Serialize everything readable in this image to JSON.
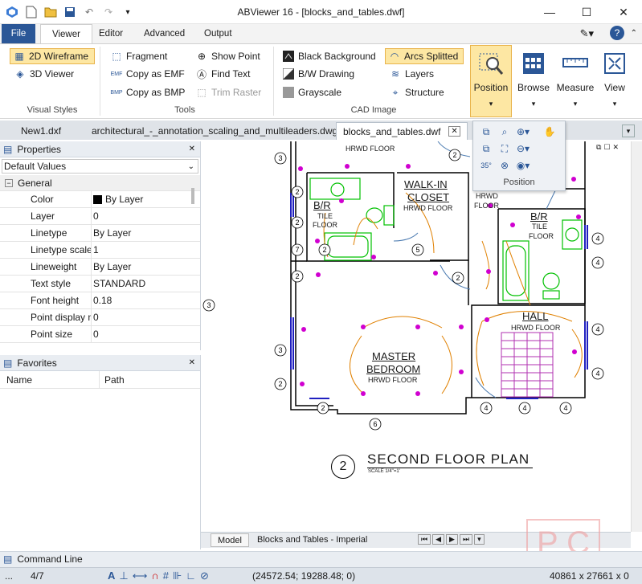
{
  "app": {
    "title": "ABViewer 16 - [blocks_and_tables.dwf]"
  },
  "ribbon_tabs": [
    "File",
    "Viewer",
    "Editor",
    "Advanced",
    "Output"
  ],
  "ribbon": {
    "visual_styles": {
      "label": "Visual Styles",
      "items": [
        "2D Wireframe",
        "3D Viewer"
      ]
    },
    "tools": {
      "label": "Tools",
      "items": [
        "Fragment",
        "Copy as EMF",
        "Copy as BMP",
        "Show Point",
        "Find Text",
        "Trim Raster"
      ]
    },
    "cad_image": {
      "label": "CAD Image",
      "items": [
        "Black Background",
        "B/W Drawing",
        "Grayscale",
        "Arcs Splitted",
        "Layers",
        "Structure"
      ]
    },
    "big_buttons": [
      "Position",
      "Browse",
      "Measure",
      "View"
    ]
  },
  "position_popup": {
    "label": "Position"
  },
  "doc_tabs": [
    "New1.dxf",
    "architectural_-_annotation_scaling_and_multileaders.dwg",
    "blocks_and_tables.dwf"
  ],
  "properties": {
    "title": "Properties",
    "dropdown": "Default Values",
    "section": "General",
    "rows": [
      {
        "name": "Color",
        "value": "By Layer"
      },
      {
        "name": "Layer",
        "value": "0"
      },
      {
        "name": "Linetype",
        "value": "By Layer"
      },
      {
        "name": "Linetype scale",
        "value": "1"
      },
      {
        "name": "Lineweight",
        "value": "By Layer"
      },
      {
        "name": "Text style",
        "value": "STANDARD"
      },
      {
        "name": "Font height",
        "value": "0.18"
      },
      {
        "name": "Point display m",
        "value": "0"
      },
      {
        "name": "Point size",
        "value": "0"
      }
    ]
  },
  "favorites": {
    "title": "Favorites",
    "columns": [
      "Name",
      "Path"
    ]
  },
  "drawing": {
    "rooms": {
      "b_r": "B/R",
      "tile": "TILE",
      "floor": "FLOOR",
      "walkin": "WALK-IN",
      "closet": "CLOSET",
      "hrwd_floor": "HRWD FLOOR",
      "hrwd": "HRWD",
      "hall": "HALL",
      "master": "MASTER",
      "bedroom": "BEDROOM"
    },
    "plan_title": "SECOND FLOOR PLAN",
    "scale": "SCALE 1/4\"=1'",
    "plan_number": "2"
  },
  "bottom_tabs": [
    "Model",
    "Blocks and Tables - Imperial"
  ],
  "command_line": {
    "title": "Command Line"
  },
  "status": {
    "page": "4/7",
    "coords": "(24572.54; 19288.48; 0)",
    "size": "40861 x 27661 x 0"
  },
  "colors": {
    "accent": "#2b5797",
    "highlight": "#fde7a3",
    "magenta": "#d000d0",
    "green": "#00c000",
    "orange": "#e08000"
  }
}
